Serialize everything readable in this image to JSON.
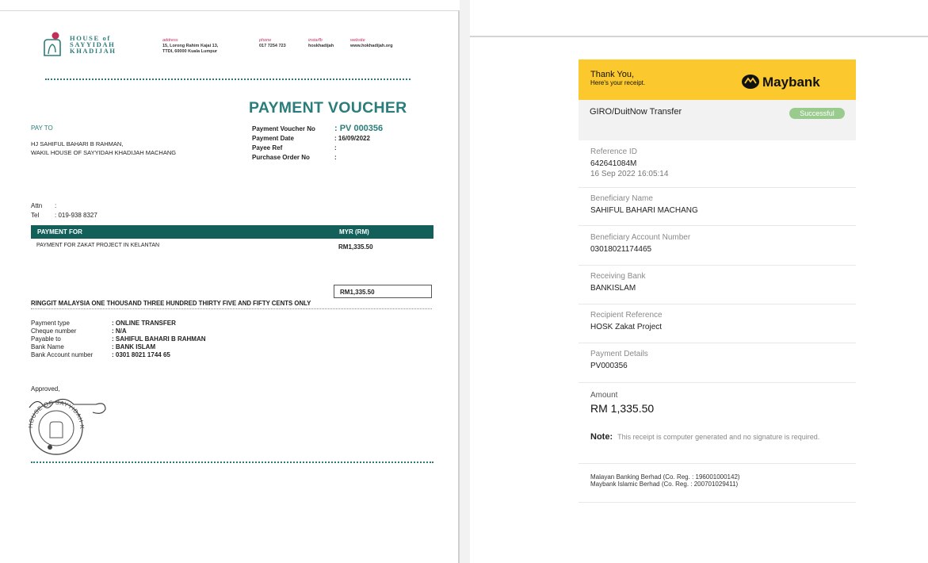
{
  "voucher": {
    "brand": {
      "line1": "HOUSE of",
      "line2": "SAYYIDAH",
      "line3": "KHADIJAH"
    },
    "contact": [
      {
        "label": "address",
        "value": "15, Lorong Rahim Kajai 13,",
        "value2": "TTDI, 60000  Kuala Lumpur"
      },
      {
        "label": "phone",
        "value": "017 7254 723"
      },
      {
        "label": "insta/fb",
        "value": "hoskhadijah"
      },
      {
        "label": "website",
        "value": "www.hokhadijah.org"
      }
    ],
    "title": "PAYMENT VOUCHER",
    "pay_to_label": "PAY TO",
    "payee_line1": "HJ SAHIFUL BAHARI B RAHMAN,",
    "payee_line2": "WAKIL HOUSE OF SAYYIDAH KHADIJAH MACHANG",
    "meta": [
      {
        "key": "Payment Voucher No",
        "value": ": PV 000356"
      },
      {
        "key": "Payment Date",
        "value": ": 16/09/2022"
      },
      {
        "key": "Payee Ref",
        "value": ":"
      },
      {
        "key": "Purchase Order No",
        "value": ":"
      }
    ],
    "attn_key": "Attn",
    "attn_val": ":",
    "tel_key": "Tel",
    "tel_val": ": 019-938 8327",
    "table_header_left": "PAYMENT FOR",
    "table_header_right": "MYR (RM)",
    "item_desc": "PAYMENT FOR ZAKAT PROJECT IN KELANTAN",
    "item_amount": "RM1,335.50",
    "total": "RM1,335.50",
    "amount_words": "RINGGIT MALAYSIA ONE THOUSAND THREE HUNDRED THIRTY FIVE AND FIFTY CENTS ONLY",
    "details": [
      {
        "key": "Payment type",
        "value": ": ONLINE TRANSFER"
      },
      {
        "key": "Cheque number",
        "value": ": N/A"
      },
      {
        "key": "Payable to",
        "value": ": SAHIFUL BAHARI B RAHMAN"
      },
      {
        "key": "Bank Name",
        "value": ": BANK ISLAM"
      },
      {
        "key": "Bank Account number",
        "value": ": 0301 8021 1744 65"
      }
    ],
    "approved": "Approved,",
    "stamp_text": "HOUSE OF SAYYIDAH KHADIJAH"
  },
  "receipt": {
    "thanks": "Thank You,",
    "thanks_sub": "Here's your receipt.",
    "logo_text": "Maybank",
    "transfer_type": "GIRO/DuitNow Transfer",
    "status": "Successful",
    "fields": [
      {
        "label": "Reference ID",
        "value": "642641084M",
        "value2": "16 Sep 2022 16:05:14"
      },
      {
        "label": "Beneficiary Name",
        "value": "SAHIFUL BAHARI MACHANG"
      },
      {
        "label": "Beneficiary Account Number",
        "value": "03018021174465"
      },
      {
        "label": "Receiving Bank",
        "value": "BANKISLAM"
      },
      {
        "label": "Recipient Reference",
        "value": "HOSK Zakat Project"
      },
      {
        "label": "Payment Details",
        "value": "PV000356"
      },
      {
        "label": "Amount",
        "value": "RM 1,335.50"
      }
    ],
    "note_label": "Note:",
    "note_text": "This receipt is computer generated and no signature is required.",
    "footer_line1": "Malayan Banking Berhad (Co. Reg. : 196001000142)",
    "footer_line2": "Maybank Islamic Berhad (Co. Reg. : 200701029411)"
  },
  "colors": {
    "teal": "#2a7d7a",
    "dark_teal": "#13605a",
    "maybank_yellow": "#fbc82d",
    "badge_green": "#9acb8e"
  }
}
